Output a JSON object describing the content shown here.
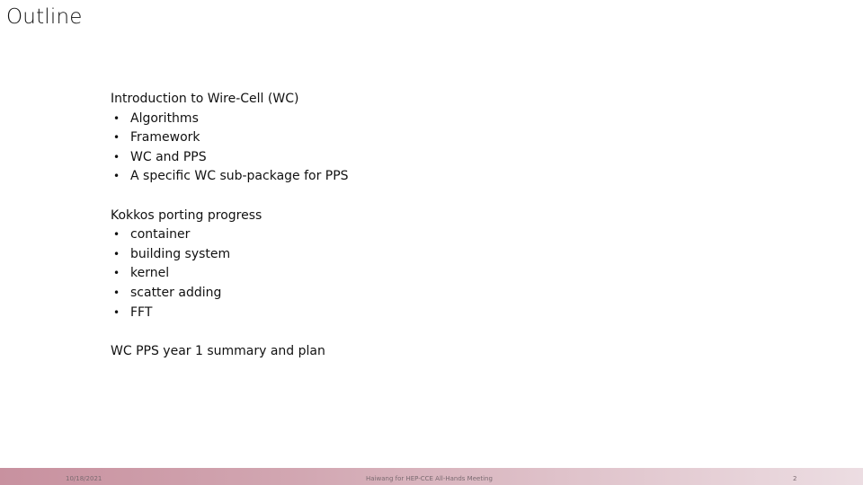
{
  "slide": {
    "title": "Outline",
    "sections": [
      {
        "heading": "Introduction to Wire-Cell (WC)",
        "bullets": [
          "Algorithms",
          "Framework",
          "WC and PPS",
          "A specific WC sub-package for PPS"
        ]
      },
      {
        "heading": "Kokkos porting progress",
        "bullets": [
          "container",
          "building system",
          "kernel",
          "scatter adding",
          "FFT"
        ]
      },
      {
        "heading": "WC PPS year 1 summary and plan",
        "bullets": []
      }
    ],
    "bullet_glyph": "•"
  },
  "footer": {
    "date": "10/18/2021",
    "center_text": "Haiwang for HEP-CCE All-Hands Meeting",
    "page_number": "2",
    "gradient_start": "#c8919f",
    "gradient_end": "#ecdde2"
  }
}
